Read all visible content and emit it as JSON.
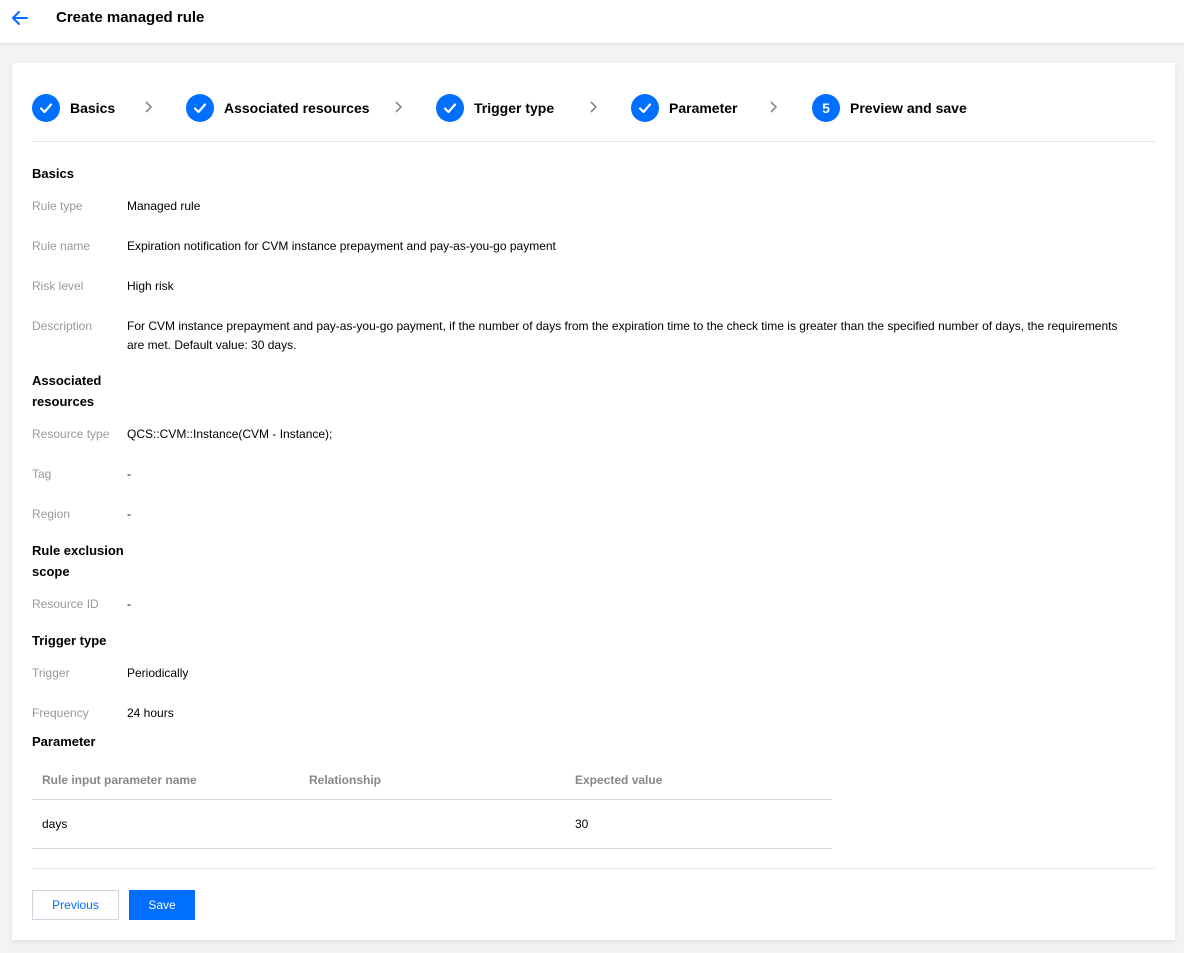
{
  "header": {
    "title": "Create managed rule",
    "back_icon": "arrow-left-icon"
  },
  "steps": [
    {
      "label": "Basics",
      "status": "done"
    },
    {
      "label": "Associated resources",
      "status": "done"
    },
    {
      "label": "Trigger type",
      "status": "done"
    },
    {
      "label": "Parameter",
      "status": "done"
    },
    {
      "label": "Preview and save",
      "status": "current",
      "number": "5"
    }
  ],
  "basics": {
    "title": "Basics",
    "rule_type_label": "Rule type",
    "rule_type_value": "Managed rule",
    "rule_name_label": "Rule name",
    "rule_name_value": "Expiration notification for CVM instance prepayment and pay-as-you-go payment",
    "risk_level_label": "Risk level",
    "risk_level_value": "High risk",
    "description_label": "Description",
    "description_value": "For CVM instance prepayment and pay-as-you-go payment, if the number of days from the expiration time to the check time is greater than the specified number of days, the requirements are met. Default value: 30 days."
  },
  "associated": {
    "title_line1": "Associated",
    "title_line2": "resources",
    "resource_type_label": "Resource type",
    "resource_type_value": "QCS::CVM::Instance(CVM - Instance);",
    "tag_label": "Tag",
    "tag_value": "-",
    "region_label": "Region",
    "region_value": "-"
  },
  "exclusion": {
    "title_line1": "Rule exclusion",
    "title_line2": "scope",
    "resource_id_label": "Resource ID",
    "resource_id_value": "-"
  },
  "trigger": {
    "title": "Trigger type",
    "trigger_label": "Trigger",
    "trigger_value": "Periodically",
    "frequency_label": "Frequency",
    "frequency_value": "24 hours"
  },
  "parameter": {
    "title": "Parameter",
    "columns": [
      "Rule input parameter name",
      "Relationship",
      "Expected value"
    ],
    "rows": [
      {
        "name": "days",
        "relationship": "",
        "expected": "30"
      }
    ]
  },
  "buttons": {
    "previous": "Previous",
    "save": "Save"
  },
  "colors": {
    "accent": "#006eff",
    "label_gray": "#999999"
  }
}
